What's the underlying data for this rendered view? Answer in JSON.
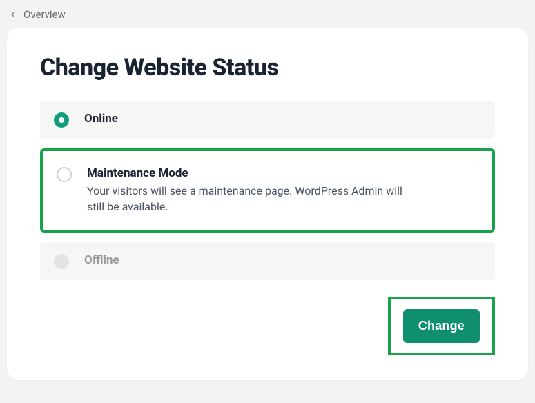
{
  "breadcrumb": {
    "back_label": "Overview"
  },
  "page": {
    "title": "Change Website Status"
  },
  "options": {
    "online": {
      "title": "Online"
    },
    "maintenance": {
      "title": "Maintenance Mode",
      "desc": "Your visitors will see a maintenance page. WordPress Admin will still be available."
    },
    "offline": {
      "title": "Offline"
    }
  },
  "actions": {
    "change_label": "Change"
  }
}
